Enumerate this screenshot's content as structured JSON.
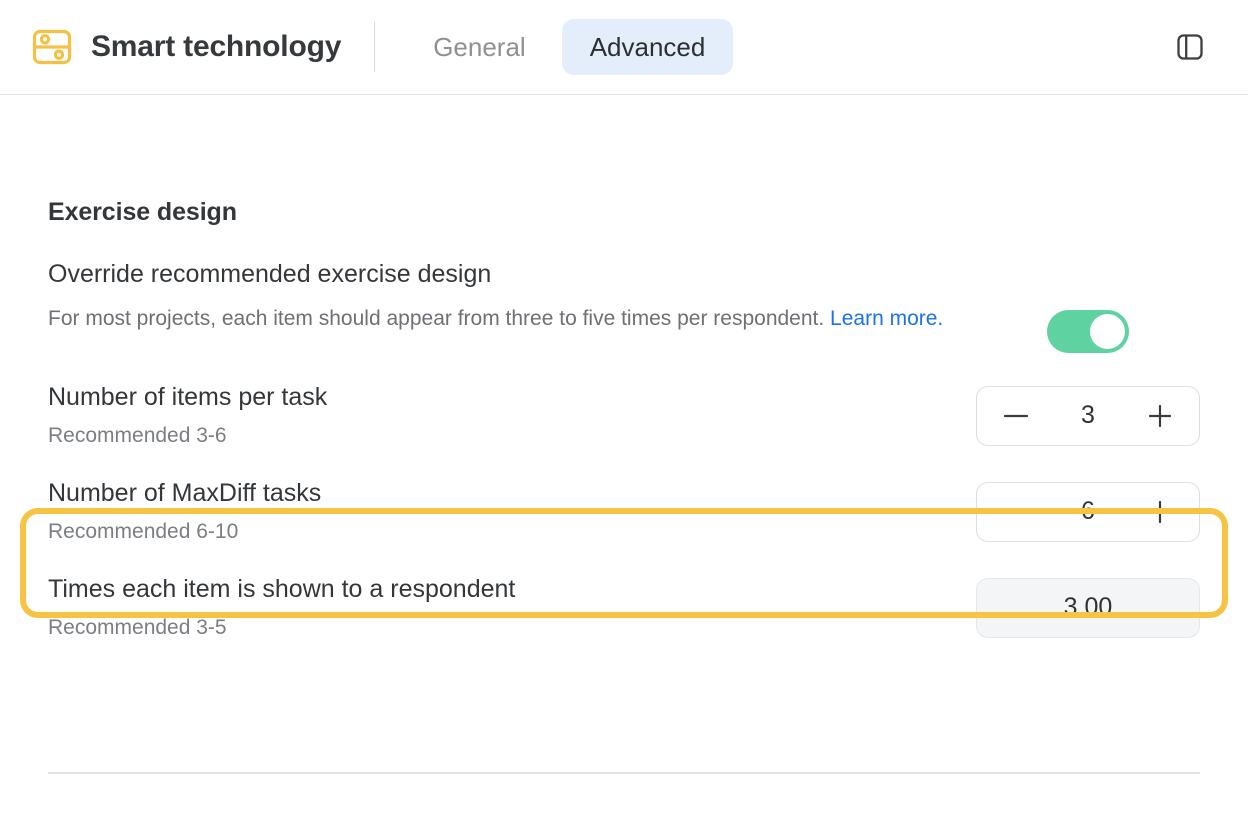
{
  "window": {
    "brand_title": "Smart technology",
    "brand_icon": "server-rack-icon",
    "panel_toggle_icon": "sidebar-panel-icon"
  },
  "tabs": [
    {
      "label": "General",
      "active": false
    },
    {
      "label": "Advanced",
      "active": true
    }
  ],
  "colors": {
    "brand_yellow": "#f5c044",
    "highlight_yellow": "#f7c343",
    "active_tab_bg": "#e4eefa",
    "toggle_on_green": "#5ed2a0",
    "link_blue": "#1a73e8"
  },
  "main": {
    "section_title": "Exercise design",
    "override": {
      "label": "Override recommended exercise design",
      "description_before_link": "For most projects, each item should appear from three to five times per respondent. ",
      "link_text": "Learn more.",
      "toggle_state": "on"
    },
    "settings": [
      {
        "title": "Number of items per task",
        "subtitle": "Recommended 3-6",
        "control": "stepper",
        "value": "3",
        "minus_label": "—",
        "plus_label": "+",
        "highlighted": false
      },
      {
        "title": "Number of MaxDiff tasks",
        "subtitle": "Recommended 6-10",
        "control": "stepper",
        "value": "6",
        "minus_label": "—",
        "plus_label": "+",
        "highlighted": true
      },
      {
        "title": "Times each item is shown to a respondent",
        "subtitle": "Recommended 3-5",
        "control": "readonly",
        "value": "3.00",
        "highlighted": false
      }
    ]
  }
}
